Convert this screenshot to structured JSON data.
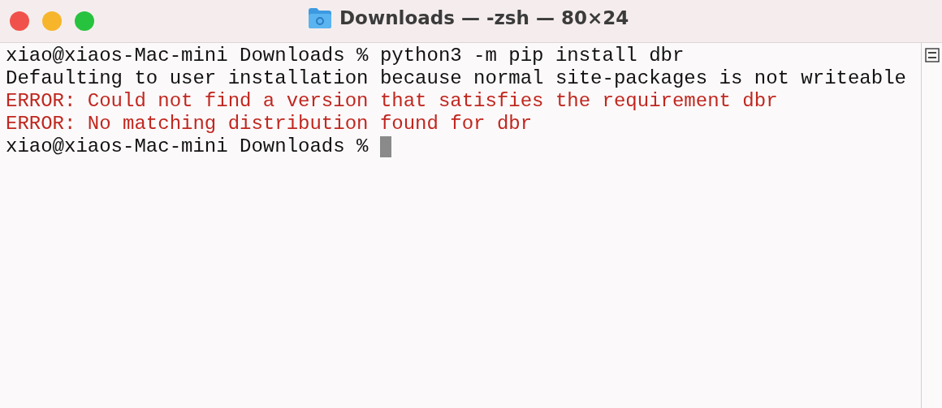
{
  "window": {
    "title": "Downloads — -zsh — 80×24"
  },
  "lines": [
    {
      "kind": "prompt",
      "prompt": "xiao@xiaos-Mac-mini Downloads %",
      "command": "python3 -m pip install dbr"
    },
    {
      "kind": "output",
      "text": "Defaulting to user installation because normal site-packages is not writeable"
    },
    {
      "kind": "error",
      "text": "ERROR: Could not find a version that satisfies the requirement dbr"
    },
    {
      "kind": "error",
      "text": "ERROR: No matching distribution found for dbr"
    },
    {
      "kind": "prompt",
      "prompt": "xiao@xiaos-Mac-mini Downloads %",
      "cursor": true
    }
  ]
}
